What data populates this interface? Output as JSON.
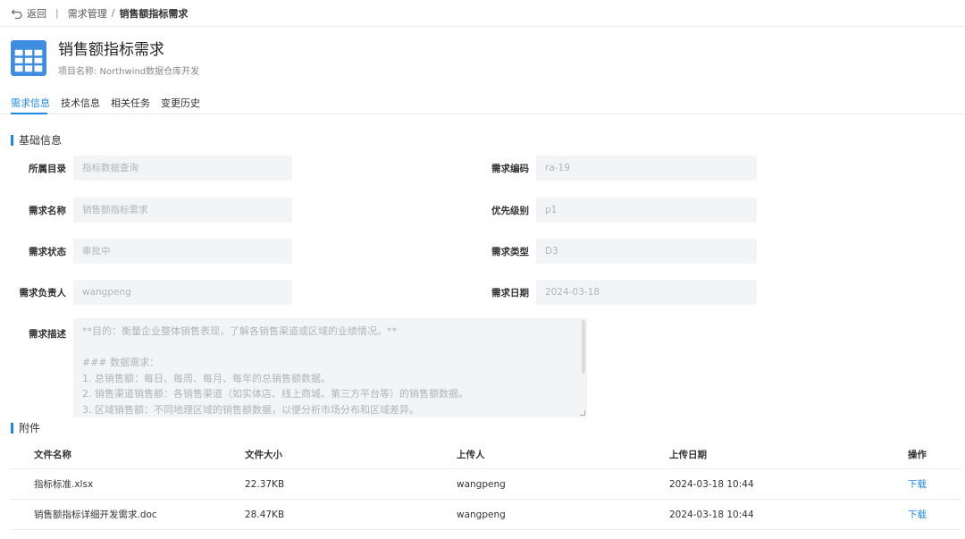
{
  "topbar": {
    "back_label": "返回",
    "separator": "|",
    "breadcrumb": [
      "需求管理",
      "销售额指标需求"
    ],
    "breadcrumb_separator": "/"
  },
  "header": {
    "title": "销售额指标需求",
    "project": "项目名称: Northwind数据仓库开发"
  },
  "tabs": [
    "需求信息",
    "技术信息",
    "相关任务",
    "变更历史"
  ],
  "active_tab": 0,
  "basic_section": {
    "title": "基础信息",
    "fields": {
      "catalog": {
        "label": "所属目录",
        "value": "指标数据查询"
      },
      "code": {
        "label": "需求编码",
        "value": "ra-19"
      },
      "name": {
        "label": "需求名称",
        "value": "销售额指标需求"
      },
      "priority": {
        "label": "优先级别",
        "value": "p1"
      },
      "status": {
        "label": "需求状态",
        "value": "审批中"
      },
      "type": {
        "label": "需求类型",
        "value": "D3"
      },
      "owner": {
        "label": "需求负责人",
        "value": "wangpeng"
      },
      "date": {
        "label": "需求日期",
        "value": "2024-03-18"
      }
    },
    "description": {
      "label": "需求描述",
      "lines": [
        "**目的：衡量企业整体销售表现，了解各销售渠道或区域的业绩情况。**",
        "",
        "### 数据需求：",
        "1. 总销售额：每日、每周、每月、每年的总销售额数据。",
        "2. 销售渠道销售额：各销售渠道（如实体店、线上商城、第三方平台等）的销售额数据。",
        "3. 区域销售额：不同地理区域的销售额数据，以便分析市场分布和区域差异。"
      ]
    }
  },
  "attachments": {
    "title": "附件",
    "columns": [
      "文件名称",
      "文件大小",
      "上传人",
      "上传日期",
      "操作"
    ],
    "rows": [
      {
        "name": "指标标准.xlsx",
        "size": "22.37KB",
        "uploader": "wangpeng",
        "date": "2024-03-18 10:44",
        "action": "下载"
      },
      {
        "name": "销售额指标详细开发需求.doc",
        "size": "28.47KB",
        "uploader": "wangpeng",
        "date": "2024-03-18 10:44",
        "action": "下载"
      }
    ]
  },
  "colors": {
    "accent": "#1e88e5",
    "field_bg": "#f3f4f6",
    "icon_blue": "#3f8de0"
  }
}
